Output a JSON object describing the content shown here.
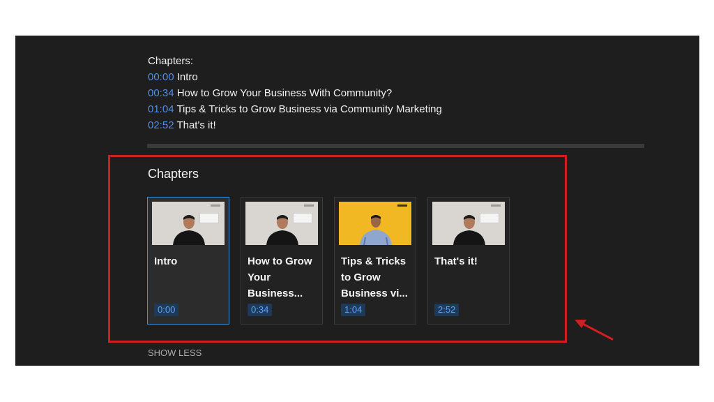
{
  "description": {
    "heading": "Chapters:",
    "lines": [
      {
        "time": "00:00",
        "title": "Intro"
      },
      {
        "time": "00:34",
        "title": "How to Grow Your Business With Community?"
      },
      {
        "time": "01:04",
        "title": "Tips & Tricks to Grow Business via Community Marketing"
      },
      {
        "time": "02:52",
        "title": "That's it!"
      }
    ]
  },
  "chapters_panel": {
    "title": "Chapters",
    "cards": [
      {
        "title": "Intro",
        "time": "0:00",
        "active": true,
        "thumb": "gray"
      },
      {
        "title": "How to Grow Your Business...",
        "time": "0:34",
        "active": false,
        "thumb": "gray"
      },
      {
        "title": "Tips & Tricks to Grow Business vi...",
        "time": "1:04",
        "active": false,
        "thumb": "yellow"
      },
      {
        "title": "That's it!",
        "time": "2:52",
        "active": false,
        "thumb": "gray"
      }
    ]
  },
  "show_less_label": "SHOW LESS",
  "colors": {
    "highlight": "#d01f1f",
    "timestamp": "#4f8fea",
    "active_border": "#3e8ed8"
  }
}
